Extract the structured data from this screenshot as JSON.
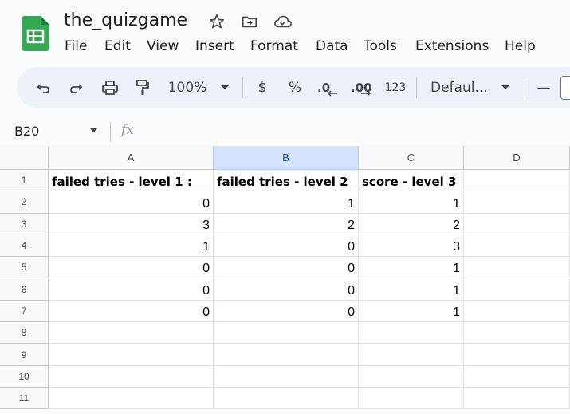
{
  "doc": {
    "title": "the_quizgame"
  },
  "menu": [
    "File",
    "Edit",
    "View",
    "Insert",
    "Format",
    "Data",
    "Tools",
    "Extensions",
    "Help"
  ],
  "toolbar": {
    "zoom": "100%",
    "currency": "$",
    "percent": "%",
    "decrease_decimal": ".0",
    "increase_decimal": ".00",
    "number_format": "123",
    "font": "Defaul...",
    "font_size_minus": "—"
  },
  "formula_bar": {
    "name_box": "B20",
    "fx": "fx"
  },
  "grid": {
    "selected_column": "B",
    "columns": [
      "A",
      "B",
      "C",
      "D"
    ],
    "row_numbers": [
      "1",
      "2",
      "3",
      "4",
      "5",
      "6",
      "7",
      "8",
      "9",
      "10",
      "11"
    ],
    "headers": [
      "failed tries - level 1 :",
      "failed tries - level 2",
      "score - level 3"
    ],
    "rows": [
      [
        "0",
        "1",
        "1"
      ],
      [
        "3",
        "2",
        "2"
      ],
      [
        "1",
        "0",
        "3"
      ],
      [
        "0",
        "0",
        "1"
      ],
      [
        "0",
        "0",
        "1"
      ],
      [
        "0",
        "0",
        "1"
      ]
    ]
  },
  "colors": {
    "sheets_green": "#34a853",
    "toolbar_bg": "#edf2fa",
    "selected_header": "#d3e3fd",
    "selected_header_text": "#0b57d0"
  }
}
